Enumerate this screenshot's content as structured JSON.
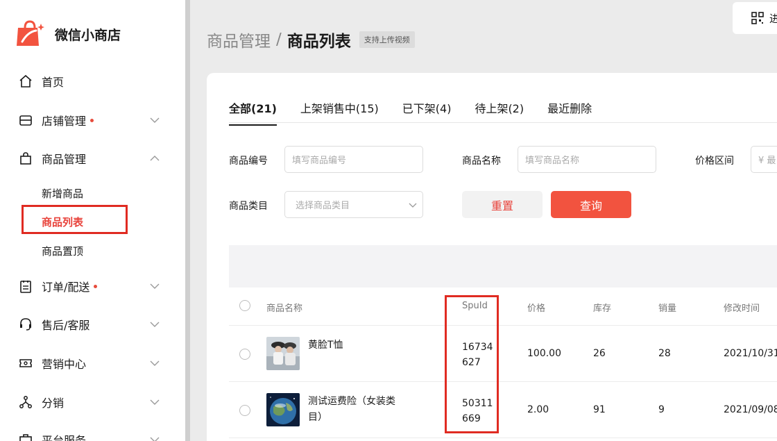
{
  "sidebar": {
    "brand": "微信小商店",
    "items": [
      {
        "label": "首页"
      },
      {
        "label": "店铺管理"
      },
      {
        "label": "商品管理"
      },
      {
        "label": "订单/配送"
      },
      {
        "label": "售后/客服"
      },
      {
        "label": "营销中心"
      },
      {
        "label": "分销"
      },
      {
        "label": "平台服务"
      }
    ],
    "subitems": [
      {
        "label": "新增商品"
      },
      {
        "label": "商品列表"
      },
      {
        "label": "商品置顶"
      }
    ]
  },
  "header": {
    "breadcrumb_parent": "商品管理",
    "breadcrumb_sep": "/",
    "breadcrumb_current": "商品列表",
    "badge": "支持上传视频",
    "top_button_text": "进"
  },
  "tabs": [
    {
      "label": "全部(21)"
    },
    {
      "label": "上架销售中(15)"
    },
    {
      "label": "已下架(4)"
    },
    {
      "label": "待上架(2)"
    },
    {
      "label": "最近删除"
    }
  ],
  "filters": {
    "product_code_label": "商品编号",
    "product_code_placeholder": "填写商品编号",
    "product_name_label": "商品名称",
    "product_name_placeholder": "填写商品名称",
    "price_range_label": "价格区间",
    "price_range_placeholder": "¥  最",
    "category_label": "商品类目",
    "category_placeholder": "选择商品类目",
    "reset_label": "重置",
    "query_label": "查询"
  },
  "table": {
    "headers": [
      "商品名称",
      "SpuId",
      "价格",
      "库存",
      "销量",
      "修改时间"
    ],
    "rows": [
      {
        "name": "黄脸T恤",
        "spuid_line1": "16734",
        "spuid_line2": "627",
        "price": "100.00",
        "stock": "26",
        "sales": "28",
        "modified": "2021/10/31"
      },
      {
        "name": "测试运费险（女装类目）",
        "spuid_line1": "50311",
        "spuid_line2": "669",
        "price": "2.00",
        "stock": "91",
        "sales": "9",
        "modified": "2021/09/08"
      }
    ]
  },
  "colors": {
    "accent": "#f2533f",
    "highlight": "#e02b22",
    "active_text": "#e8433b"
  }
}
